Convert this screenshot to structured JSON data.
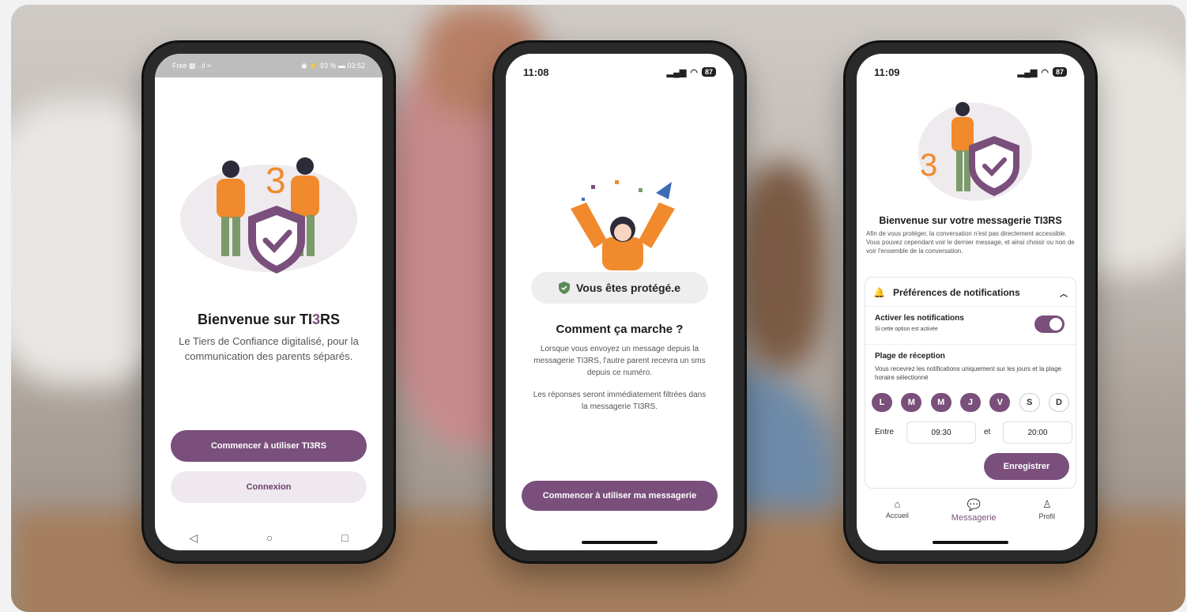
{
  "colors": {
    "accent": "#7a4f7c",
    "accent_light": "#efe8ef",
    "orange": "#f08a2c",
    "green": "#7a9a6a"
  },
  "phone1": {
    "status_left": "Free ▦ ..ıl ≈",
    "status_right": "◉ ⚡ 93 % ▬ 03:52",
    "title_prefix": "Bienvenue sur TI",
    "title_accent": "3",
    "title_suffix": "RS",
    "subtitle": "Le Tiers de Confiance digitalisé, pour la communication des parents séparés.",
    "primary_button": "Commencer à utiliser TI3RS",
    "secondary_button": "Connexion",
    "nav_icons": [
      "back-icon",
      "home-icon",
      "recents-icon"
    ]
  },
  "phone2": {
    "time": "11:08",
    "battery": "87",
    "chip": "Vous êtes protégé.e",
    "title": "Comment ça marche ?",
    "body1": "Lorsque vous envoyez un message depuis la messagerie TI3RS, l'autre parent recevra un sms depuis ce numéro.",
    "body2": "Les réponses seront immédiatement filtrées dans la messagerie TI3RS.",
    "button": "Commencer à utiliser ma messagerie"
  },
  "phone3": {
    "time": "11:09",
    "battery": "87",
    "title": "Bienvenue sur votre messagerie TI3RS",
    "intro": "Afin de vous protéger, la conversation n'est pas directement accessible. Vous pouvez cependant voir le dernier message, et ainsi choisir ou non de voir l'ensemble de la conversation.",
    "prefs_header": "Préférences de notifications",
    "notif_label": "Activer les notifications",
    "notif_sub": "Si cette option est activée",
    "range_title": "Plage de réception",
    "range_desc": "Vous recevrez les notifications uniquement sur les jours et la plage horaire sélectionné",
    "days": [
      {
        "label": "L",
        "on": true
      },
      {
        "label": "M",
        "on": true
      },
      {
        "label": "M",
        "on": true
      },
      {
        "label": "J",
        "on": true
      },
      {
        "label": "V",
        "on": true
      },
      {
        "label": "S",
        "on": false
      },
      {
        "label": "D",
        "on": false
      }
    ],
    "between_label": "Entre",
    "start_time": "09:30",
    "and_label": "et",
    "end_time": "20:00",
    "save_button": "Enregistrer",
    "tabs": [
      {
        "label": "Accueil",
        "icon": "home-icon"
      },
      {
        "label": "Messagerie",
        "icon": "chat-icon"
      },
      {
        "label": "Profil",
        "icon": "user-icon"
      }
    ]
  }
}
